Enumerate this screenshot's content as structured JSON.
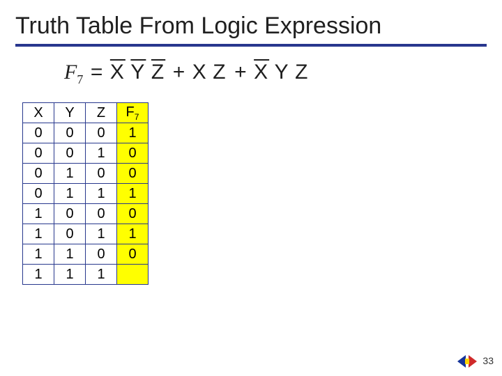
{
  "title": "Truth Table From Logic Expression",
  "expression": {
    "fn_label": "F",
    "fn_sub": "7",
    "eq": "=",
    "t1a": "X",
    "t1b": "Y",
    "t1c": "Z",
    "plus": "+",
    "t2a": "X",
    "t2b": "Z",
    "t3a": "X",
    "t3b": "Y",
    "t3c": "Z"
  },
  "headers": {
    "c0": "X",
    "c1": "Y",
    "c2": "Z",
    "c3": "F",
    "c3sub": "7"
  },
  "rows": [
    {
      "x": "0",
      "y": "0",
      "z": "0",
      "f": "1"
    },
    {
      "x": "0",
      "y": "0",
      "z": "1",
      "f": "0"
    },
    {
      "x": "0",
      "y": "1",
      "z": "0",
      "f": "0"
    },
    {
      "x": "0",
      "y": "1",
      "z": "1",
      "f": "1"
    },
    {
      "x": "1",
      "y": "0",
      "z": "0",
      "f": "0"
    },
    {
      "x": "1",
      "y": "0",
      "z": "1",
      "f": "1"
    },
    {
      "x": "1",
      "y": "1",
      "z": "0",
      "f": "0"
    },
    {
      "x": "1",
      "y": "1",
      "z": "1",
      "f": ""
    }
  ],
  "page_number": "33"
}
